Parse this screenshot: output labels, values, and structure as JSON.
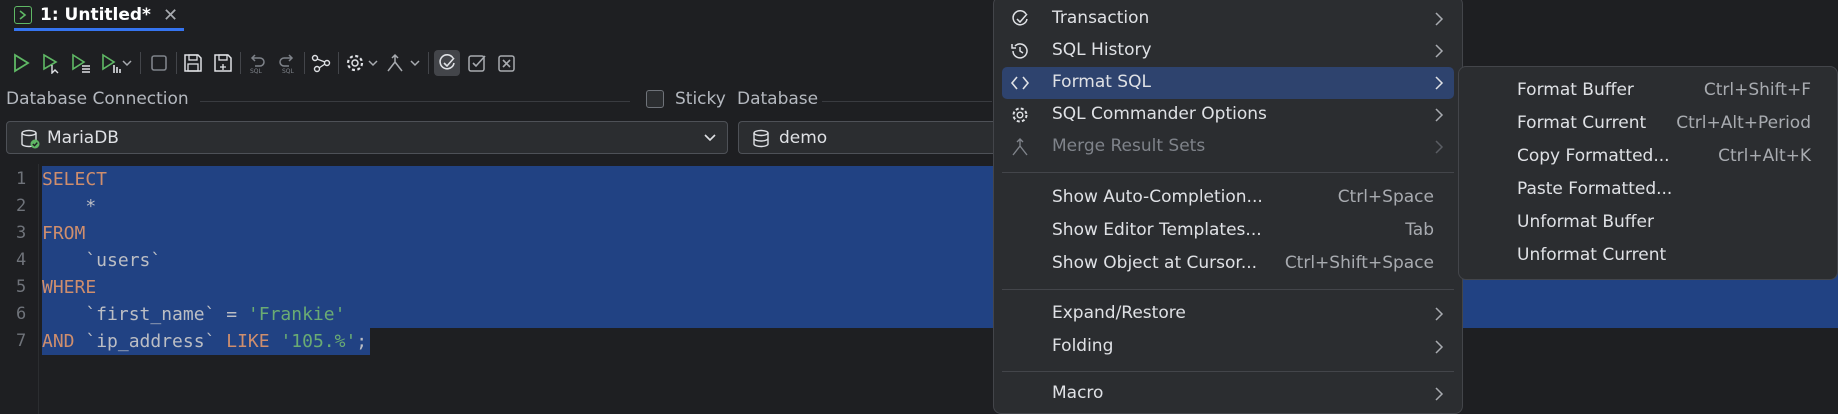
{
  "tab": {
    "title": "1: Untitled*"
  },
  "labels": {
    "connection": "Database Connection",
    "sticky": "Sticky",
    "database": "Database"
  },
  "connection": {
    "value": "MariaDB"
  },
  "database": {
    "value": "demo"
  },
  "editor": {
    "line_numbers": [
      "1",
      "2",
      "3",
      "4",
      "5",
      "6",
      "7"
    ],
    "lines": [
      [
        {
          "t": "SELECT",
          "c": "kw"
        }
      ],
      [
        {
          "t": "    *",
          "c": "id"
        }
      ],
      [
        {
          "t": "FROM",
          "c": "kw"
        }
      ],
      [
        {
          "t": "    `users`",
          "c": "id"
        }
      ],
      [
        {
          "t": "WHERE",
          "c": "kw"
        }
      ],
      [
        {
          "t": "    `first_name` = ",
          "c": "id"
        },
        {
          "t": "'Frankie'",
          "c": "str"
        }
      ],
      [
        {
          "t": "AND ",
          "c": "kw"
        },
        {
          "t": "`ip_address` ",
          "c": "id"
        },
        {
          "t": "LIKE ",
          "c": "kw"
        },
        {
          "t": "'105.%'",
          "c": "str"
        },
        {
          "t": ";",
          "c": "pn"
        }
      ]
    ]
  },
  "context_menu": {
    "transaction": "Transaction",
    "sql_history": "SQL History",
    "format_sql": "Format SQL",
    "sql_commander_options": "SQL Commander Options",
    "merge_result_sets": "Merge Result Sets",
    "show_auto_completion": "Show Auto-Completion...",
    "show_auto_completion_shortcut": "Ctrl+Space",
    "show_editor_templates": "Show Editor Templates...",
    "show_editor_templates_shortcut": "Tab",
    "show_object_at_cursor": "Show Object at Cursor...",
    "show_object_at_cursor_shortcut": "Ctrl+Shift+Space",
    "expand_restore": "Expand/Restore",
    "folding": "Folding",
    "macro": "Macro"
  },
  "submenu": {
    "format_buffer": "Format Buffer",
    "format_buffer_shortcut": "Ctrl+Shift+F",
    "format_current": "Format Current",
    "format_current_shortcut": "Ctrl+Alt+Period",
    "copy_formatted": "Copy Formatted...",
    "copy_formatted_shortcut": "Ctrl+Alt+K",
    "paste_formatted": "Paste Formatted...",
    "unformat_buffer": "Unformat Buffer",
    "unformat_current": "Unformat Current"
  },
  "colors": {
    "accent": "#3574f0",
    "selection": "#214283",
    "menu_highlight": "#2e436e",
    "keyword": "#cf8e6d",
    "string": "#6aab73"
  }
}
